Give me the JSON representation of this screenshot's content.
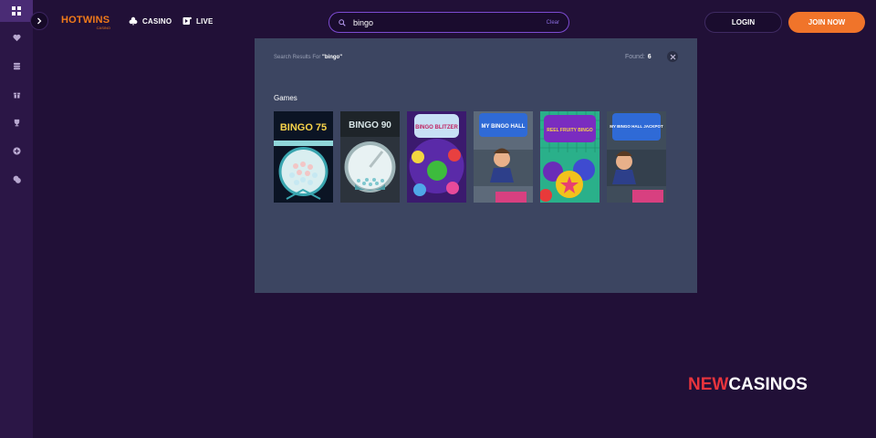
{
  "rail": {
    "items": [
      "dashboard-icon",
      "heart-icon",
      "coins-icon",
      "gift-icon",
      "trophy-icon",
      "plus-icon",
      "chips-icon"
    ]
  },
  "header": {
    "logo_main": "HOTWINS",
    "logo_sub": "CASINO",
    "nav": [
      {
        "label": "CASINO",
        "icon": "clubs-icon"
      },
      {
        "label": "LIVE",
        "icon": "live-icon"
      }
    ],
    "search": {
      "value": "bingo",
      "clear_label": "Clear"
    },
    "login_label": "LOGIN",
    "join_label": "JOIN NOW"
  },
  "results": {
    "prefix": "Search Results For",
    "query": "\"bingo\"",
    "found_label": "Found:",
    "found_count": "6",
    "section_title": "Games",
    "games": [
      {
        "title": "BINGO 75"
      },
      {
        "title": "BINGO 90"
      },
      {
        "title": "BINGO BLITZER"
      },
      {
        "title": "MY BINGO HALL"
      },
      {
        "title": "REEL FRUITY BINGO"
      },
      {
        "title": "MY BINGO HALL JACKPOT"
      }
    ]
  },
  "watermark": {
    "part_a": "NEW",
    "part_b": "CASINOS"
  },
  "colors": {
    "background": "#211037",
    "rail": "#2b1646",
    "panel": "#3c4561",
    "accent_orange": "#f0742a",
    "search_border": "#7c4bd1"
  }
}
